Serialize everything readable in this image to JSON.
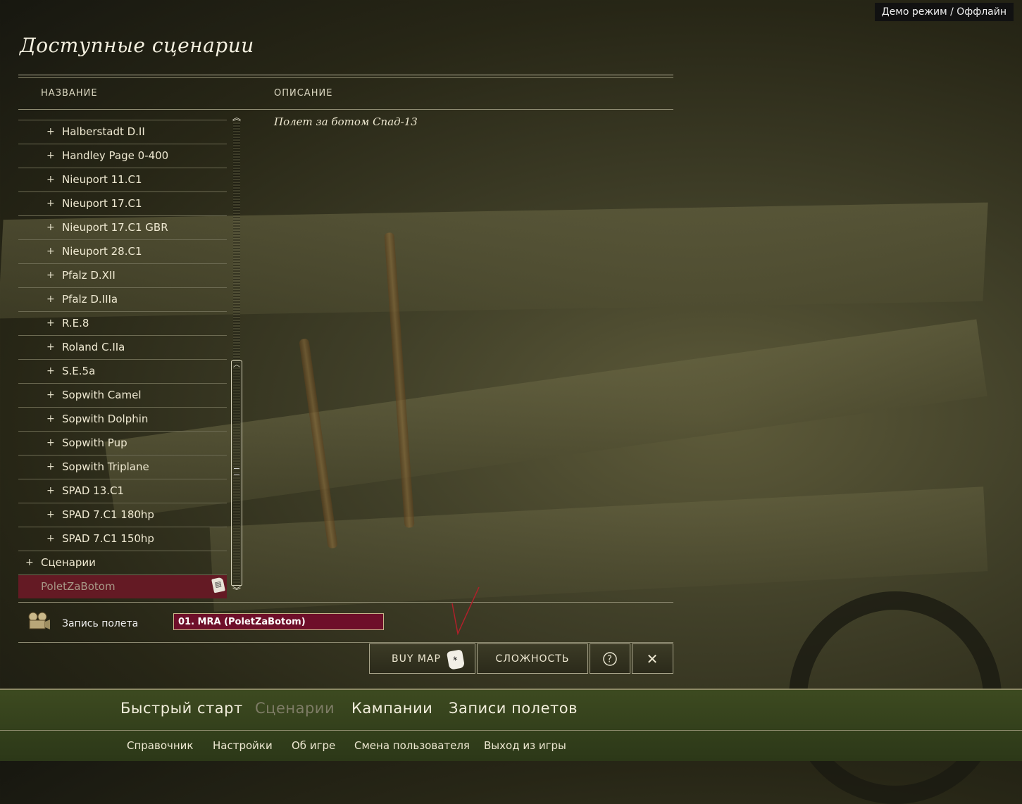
{
  "status": "Демо режим / Оффлайн",
  "title": "Доступные сценарии",
  "columns": {
    "name": "НАЗВАНИЕ",
    "description": "ОПИСАНИЕ"
  },
  "list": [
    {
      "label": "Halberstadt D.II"
    },
    {
      "label": "Handley Page 0-400"
    },
    {
      "label": "Nieuport 11.C1"
    },
    {
      "label": "Nieuport 17.C1"
    },
    {
      "label": "Nieuport 17.C1 GBR"
    },
    {
      "label": "Nieuport 28.C1"
    },
    {
      "label": "Pfalz D.XII"
    },
    {
      "label": "Pfalz D.IIIa"
    },
    {
      "label": "R.E.8"
    },
    {
      "label": "Roland C.IIa"
    },
    {
      "label": "S.E.5a"
    },
    {
      "label": "Sopwith Camel"
    },
    {
      "label": "Sopwith Dolphin"
    },
    {
      "label": "Sopwith Pup"
    },
    {
      "label": "Sopwith Triplane"
    },
    {
      "label": "SPAD 13.C1"
    },
    {
      "label": "SPAD 7.C1 180hp"
    },
    {
      "label": "SPAD 7.C1 150hp"
    }
  ],
  "group": {
    "label": "Сценарии"
  },
  "selected": {
    "label": "PoletZaBotom"
  },
  "description_text": "Полет за ботом Спад-13",
  "record": {
    "label": "Запись полета",
    "value": "01. MRA (PoletZaBotom)"
  },
  "buttons": {
    "buy_map": "BUY MAP",
    "difficulty": "СЛОЖНОСТЬ",
    "help": "?",
    "close": "✕"
  },
  "nav": [
    "Быстрый старт",
    "Сценарии",
    "Кампании",
    "Записи полетов"
  ],
  "nav_active": "Сценарии",
  "subnav": [
    "Справочник",
    "Настройки",
    "Об игре",
    "Смена пользователя",
    "Выход из игры"
  ]
}
